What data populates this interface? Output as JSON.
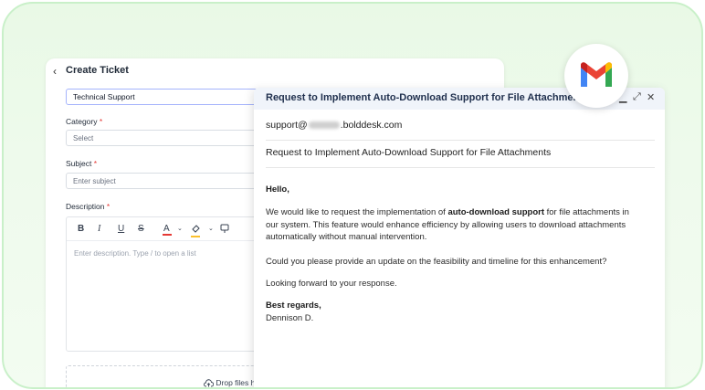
{
  "ticket": {
    "back_icon": "chevron-left-icon",
    "title": "Create Ticket",
    "type_value": "Technical Support",
    "category_label": "Category",
    "category_placeholder": "Select",
    "subject_label": "Subject",
    "subject_placeholder": "Enter subject",
    "description_label": "Description",
    "required_mark": "*",
    "editor_placeholder": "Enter description. Type / to open a list",
    "toolbar": [
      "B",
      "I",
      "U",
      "S",
      "A"
    ],
    "drop_label": "Drop files h"
  },
  "email": {
    "header_subject": "Request to Implement Auto-Download Support for File Attachments",
    "to_prefix": "support@",
    "to_suffix": ".bolddesk.com",
    "subject": "Request to Implement Auto-Download Support for File Attachments",
    "greeting": "Hello,",
    "p1_before": "We would like to request the implementation of ",
    "p1_bold": "auto-download support",
    "p1_after": " for file attachments in our system. This feature would enhance efficiency by allowing users to download attachments automatically without manual intervention.",
    "p2": "Could you please provide an update on the feasibility and timeline for this enhancement?",
    "p3": "Looking forward to your response.",
    "signoff": "Best regards,",
    "signature": "Dennison D."
  },
  "colors": {
    "background": "#e9f9e6",
    "frame_border": "#c9f0c9",
    "email_header": "#f0f4fa",
    "required": "#e53935",
    "gmail_red": "#ea4335",
    "gmail_blue": "#4285f4",
    "gmail_green": "#34a853",
    "gmail_yellow": "#fbbc04"
  },
  "icons": {
    "gmail": "gmail-logo",
    "minimize": "minimize-icon",
    "expand": "expand-icon",
    "close": "close-icon"
  }
}
